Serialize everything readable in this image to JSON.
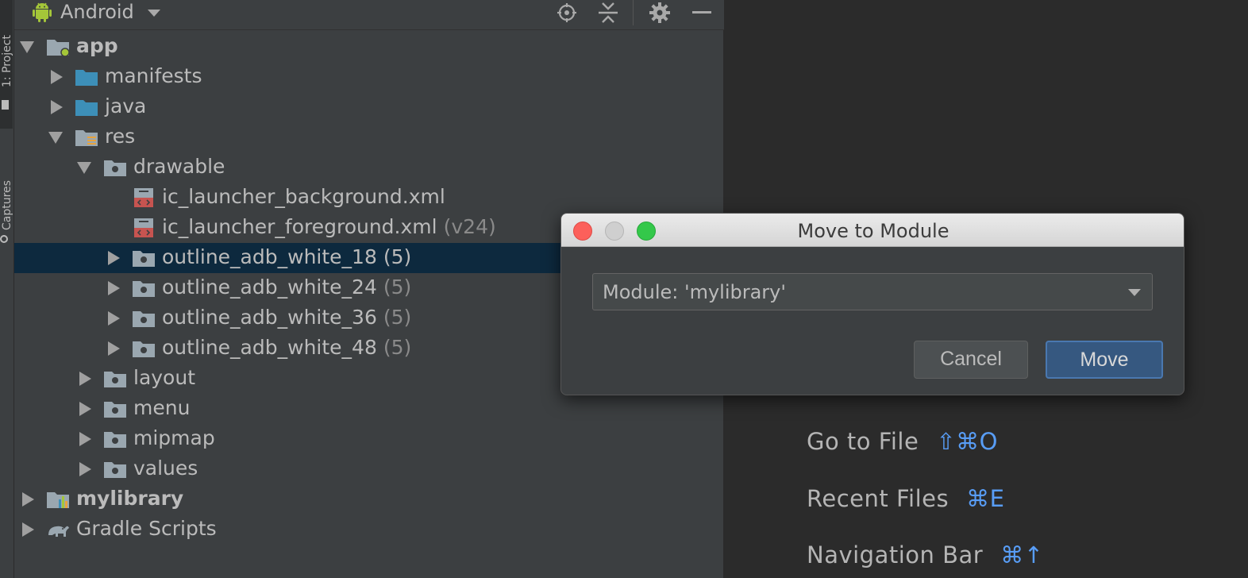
{
  "side_strip": {
    "tab_project": "1: Project",
    "tab_captures": "Captures"
  },
  "panel": {
    "view_mode": "Android",
    "tree": [
      {
        "label": "app",
        "count": "",
        "bold": true,
        "expanded": true,
        "depth": 0,
        "icon": "module-icon"
      },
      {
        "label": "manifests",
        "count": "",
        "expanded": false,
        "depth": 1,
        "icon": "folder-icon"
      },
      {
        "label": "java",
        "count": "",
        "expanded": false,
        "depth": 1,
        "icon": "folder-icon"
      },
      {
        "label": "res",
        "count": "",
        "expanded": true,
        "depth": 1,
        "icon": "res-folder-icon"
      },
      {
        "label": "drawable",
        "count": "",
        "expanded": true,
        "depth": 2,
        "icon": "package-folder-icon"
      },
      {
        "label": "ic_launcher_background.xml",
        "count": "",
        "depth": 3,
        "icon": "xml-file-icon"
      },
      {
        "label": "ic_launcher_foreground.xml",
        "count": "(v24)",
        "depth": 3,
        "icon": "xml-file-icon"
      },
      {
        "label": "outline_adb_white_18",
        "count": "(5)",
        "expanded": false,
        "selected": true,
        "depth": 3,
        "icon": "package-folder-icon"
      },
      {
        "label": "outline_adb_white_24",
        "count": "(5)",
        "expanded": false,
        "depth": 3,
        "icon": "package-folder-icon"
      },
      {
        "label": "outline_adb_white_36",
        "count": "(5)",
        "expanded": false,
        "depth": 3,
        "icon": "package-folder-icon"
      },
      {
        "label": "outline_adb_white_48",
        "count": "(5)",
        "expanded": false,
        "depth": 3,
        "icon": "package-folder-icon"
      },
      {
        "label": "layout",
        "count": "",
        "expanded": false,
        "depth": 2,
        "icon": "package-folder-icon"
      },
      {
        "label": "menu",
        "count": "",
        "expanded": false,
        "depth": 2,
        "icon": "package-folder-icon"
      },
      {
        "label": "mipmap",
        "count": "",
        "expanded": false,
        "depth": 2,
        "icon": "package-folder-icon"
      },
      {
        "label": "values",
        "count": "",
        "expanded": false,
        "depth": 2,
        "icon": "package-folder-icon"
      },
      {
        "label": "mylibrary",
        "count": "",
        "bold": true,
        "expanded": false,
        "depth": 0,
        "icon": "library-module-icon"
      },
      {
        "label": "Gradle Scripts",
        "count": "",
        "expanded": false,
        "depth": 0,
        "icon": "gradle-icon"
      }
    ]
  },
  "editor": {
    "hints": [
      {
        "label": "Go to File",
        "shortcut": "⇧⌘O"
      },
      {
        "label": "Recent Files",
        "shortcut": "⌘E"
      },
      {
        "label": "Navigation Bar",
        "shortcut": "⌘↑"
      }
    ]
  },
  "dialog": {
    "title": "Move to Module",
    "module_select": "Module: 'mylibrary'",
    "cancel_label": "Cancel",
    "move_label": "Move"
  },
  "colors": {
    "selection": "#0d293e",
    "folder_blue": "#3d8fb8",
    "shortcut_blue": "#589df6",
    "android_green": "#a4c639"
  }
}
